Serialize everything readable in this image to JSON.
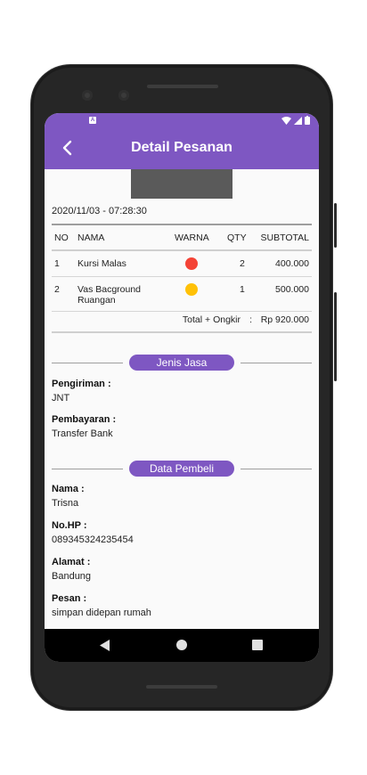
{
  "app": {
    "title": "Detail Pesanan"
  },
  "order": {
    "datetime": "2020/11/03 - 07:28:30",
    "columns": [
      "NO",
      "NAMA",
      "WARNA",
      "QTY",
      "SUBTOTAL"
    ],
    "items": [
      {
        "no": "1",
        "nama": "Kursi Malas",
        "warna": "#f44336",
        "qty": "2",
        "subtotal": "400.000"
      },
      {
        "no": "2",
        "nama": "Vas Bacground Ruangan",
        "warna": "#ffc107",
        "qty": "1",
        "subtotal": "500.000"
      }
    ],
    "total_label": "Total + Ongkir",
    "total_colon": ":",
    "total_value": "Rp 920.000"
  },
  "jasa": {
    "section_label": "Jenis Jasa",
    "pengiriman_label": "Pengiriman :",
    "pengiriman_value": "JNT",
    "pembayaran_label": "Pembayaran :",
    "pembayaran_value": "Transfer Bank"
  },
  "pembeli": {
    "section_label": "Data Pembeli",
    "nama_label": "Nama :",
    "nama_value": "Trisna",
    "hp_label": "No.HP :",
    "hp_value": "089345324235454",
    "alamat_label": "Alamat :",
    "alamat_value": "Bandung",
    "pesan_label": "Pesan :",
    "pesan_value": "simpan didepan rumah"
  },
  "colors": {
    "primary": "#7e57c2",
    "screen_bg": "#fafafa"
  },
  "icons": {
    "back": "back-arrow-icon",
    "nav": [
      "back-triangle-icon",
      "home-circle-icon",
      "recents-square-icon"
    ]
  }
}
